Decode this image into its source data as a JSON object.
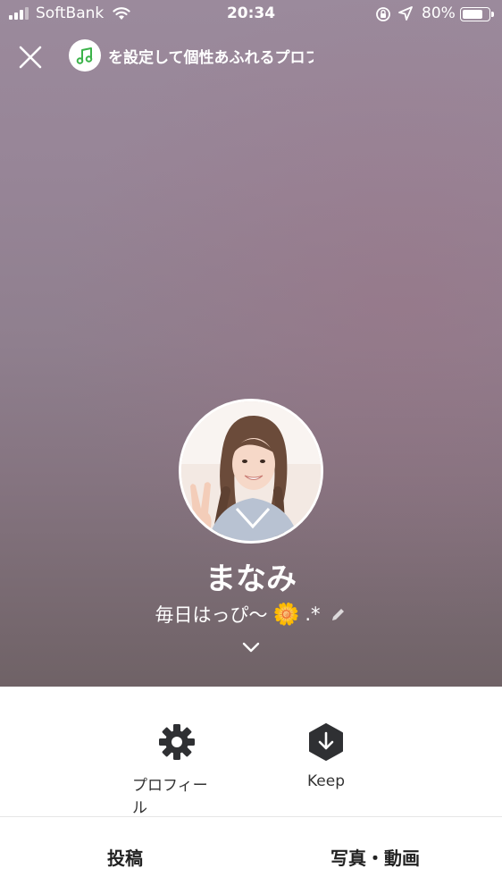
{
  "status_bar": {
    "carrier": "SoftBank",
    "time": "20:34",
    "battery_percent": "80%",
    "battery_level": 0.8,
    "signal_icon": "signal-bars-icon",
    "wifi_icon": "wifi-icon",
    "rotation_icon": "rotation-lock-icon",
    "location_icon": "location-arrow-icon"
  },
  "header": {
    "close_icon": "close-icon",
    "music_icon": "music-note-icon",
    "music_text": "を設定して個性あふれるプロフ"
  },
  "profile": {
    "name": "まなみ",
    "status_message": "毎日はっぴ〜",
    "status_suffix": ".*",
    "flower_emoji": "🌼",
    "edit_icon": "pencil-icon",
    "expand_icon": "chevron-down-icon"
  },
  "actions": {
    "profile_label": "プロフィール",
    "profile_icon": "gear-icon",
    "keep_label": "Keep",
    "keep_icon": "keep-download-icon"
  },
  "tabs": {
    "posts": "投稿",
    "photos_videos": "写真・動画"
  },
  "colors": {
    "music_green": "#3cb34a",
    "keep_dark": "#2f3033",
    "gear_dark": "#2f3033"
  }
}
